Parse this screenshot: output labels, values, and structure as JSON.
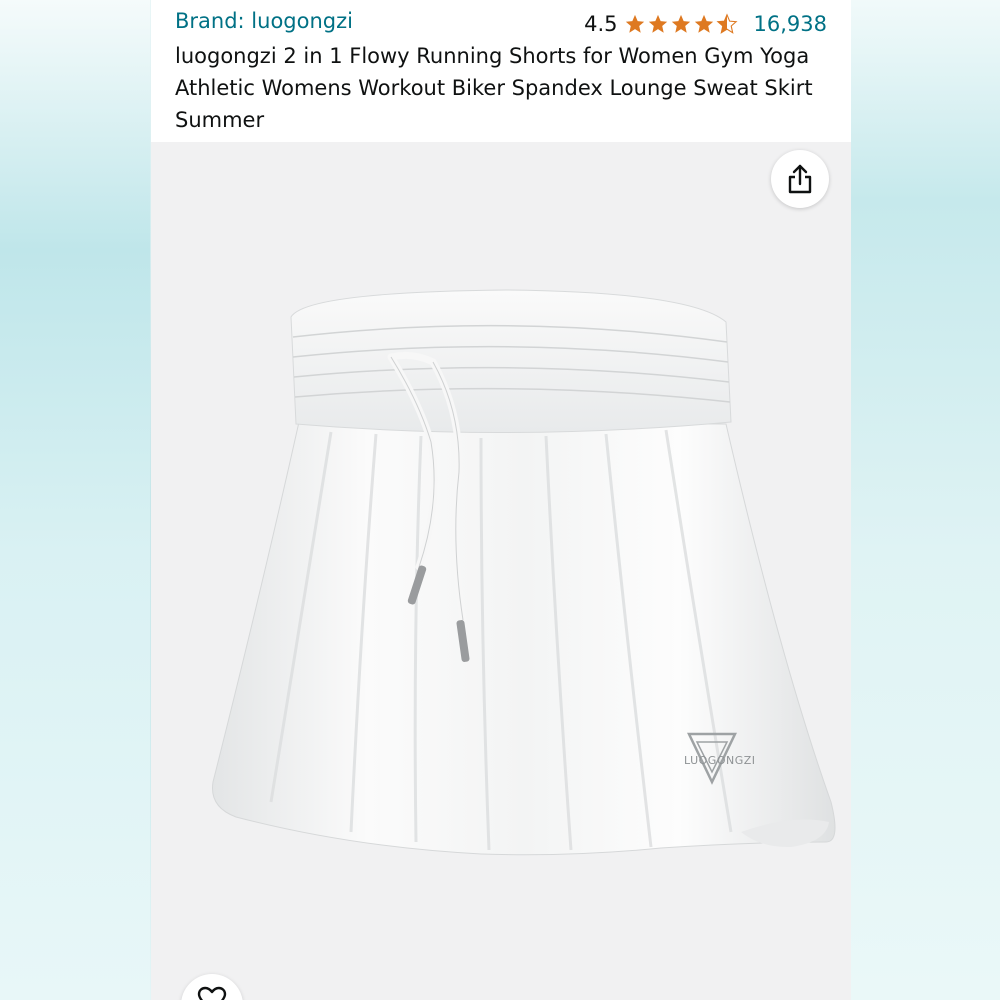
{
  "product": {
    "brand_label": "Brand: luogongzi",
    "rating_value": "4.5",
    "rating_stars": 4.5,
    "review_count": "16,938",
    "title": "luogongzi 2 in 1 Flowy Running Shorts for Women Gym Yoga Athletic Womens Workout Biker Spandex Lounge Sweat Skirt Summer"
  },
  "image": {
    "logo_text": "LUOGONGZI",
    "share_icon": "share-icon",
    "wishlist_icon": "heart-icon"
  },
  "colors": {
    "link": "#007185",
    "star": "#de7921",
    "text": "#0f1111",
    "image_bg": "#f1f1f2"
  }
}
